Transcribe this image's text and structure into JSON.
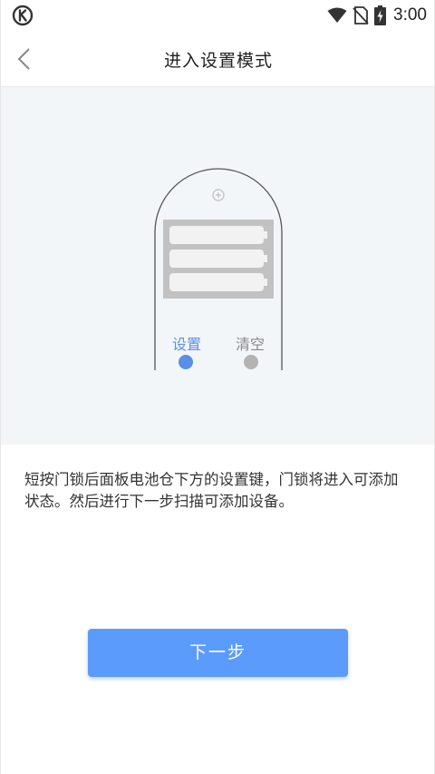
{
  "status_bar": {
    "time": "3:00",
    "icons": [
      "k-app-icon",
      "wifi-icon",
      "sim-off-icon",
      "battery-charging-icon"
    ]
  },
  "nav": {
    "back_icon": "chevron-left-icon",
    "title": "进入设置模式"
  },
  "illustration": {
    "setup_label": "设置",
    "clear_label": "清空",
    "setup_color": "#5a8fe6",
    "clear_color": "#b3b3b3"
  },
  "instruction": "短按门锁后面板电池仓下方的设置键，门锁将进入可添加状态。然后进行下一步扫描可添加设备。",
  "next_button": {
    "label": "下一步",
    "color": "#5b9bfb"
  }
}
